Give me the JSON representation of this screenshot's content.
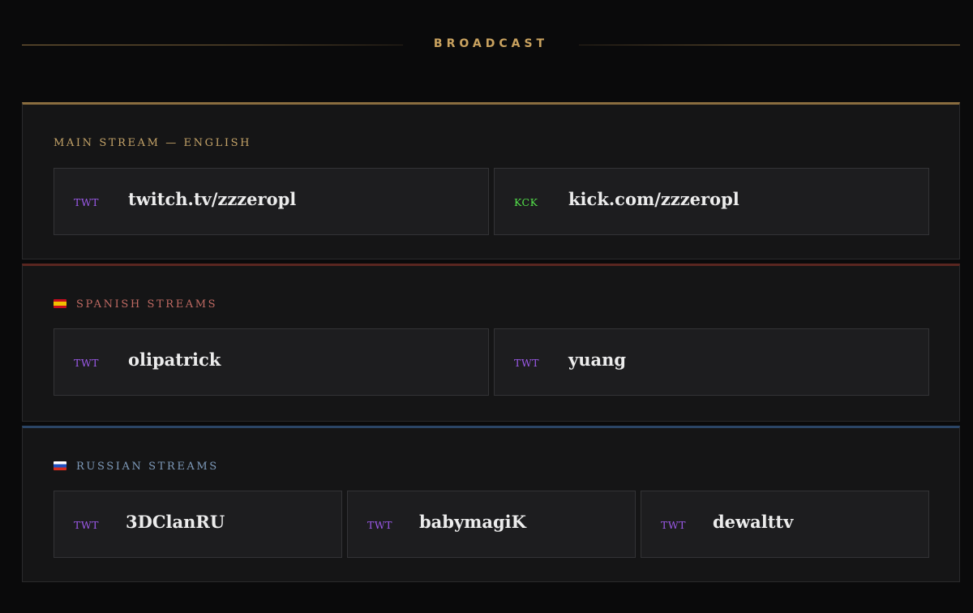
{
  "header": {
    "title": "BROADCAST"
  },
  "sections": [
    {
      "label": "MAIN STREAM — ENGLISH",
      "streams": [
        {
          "platform": "TWT",
          "name": "twitch.tv/zzzeropl"
        },
        {
          "platform": "KCK",
          "name": "kick.com/zzzeropl"
        }
      ]
    },
    {
      "label": "SPANISH STREAMS",
      "flag": "spain-flag-icon",
      "streams": [
        {
          "platform": "TWT",
          "name": "olipatrick"
        },
        {
          "platform": "TWT",
          "name": "yuang"
        }
      ]
    },
    {
      "label": "RUSSIAN STREAMS",
      "flag": "russia-flag-icon",
      "streams": [
        {
          "platform": "TWT",
          "name": "3DClanRU"
        },
        {
          "platform": "TWT",
          "name": "babymagiK"
        },
        {
          "platform": "TWT",
          "name": "dewalttv"
        }
      ]
    }
  ],
  "colors": {
    "background": "#0a0a0b",
    "gold_accent": "#c9a25f",
    "spanish_accent": "#c06a63",
    "russian_accent": "#7f9bbb",
    "twitch_badge": "#9b59e8",
    "kick_badge": "#53e04a"
  }
}
